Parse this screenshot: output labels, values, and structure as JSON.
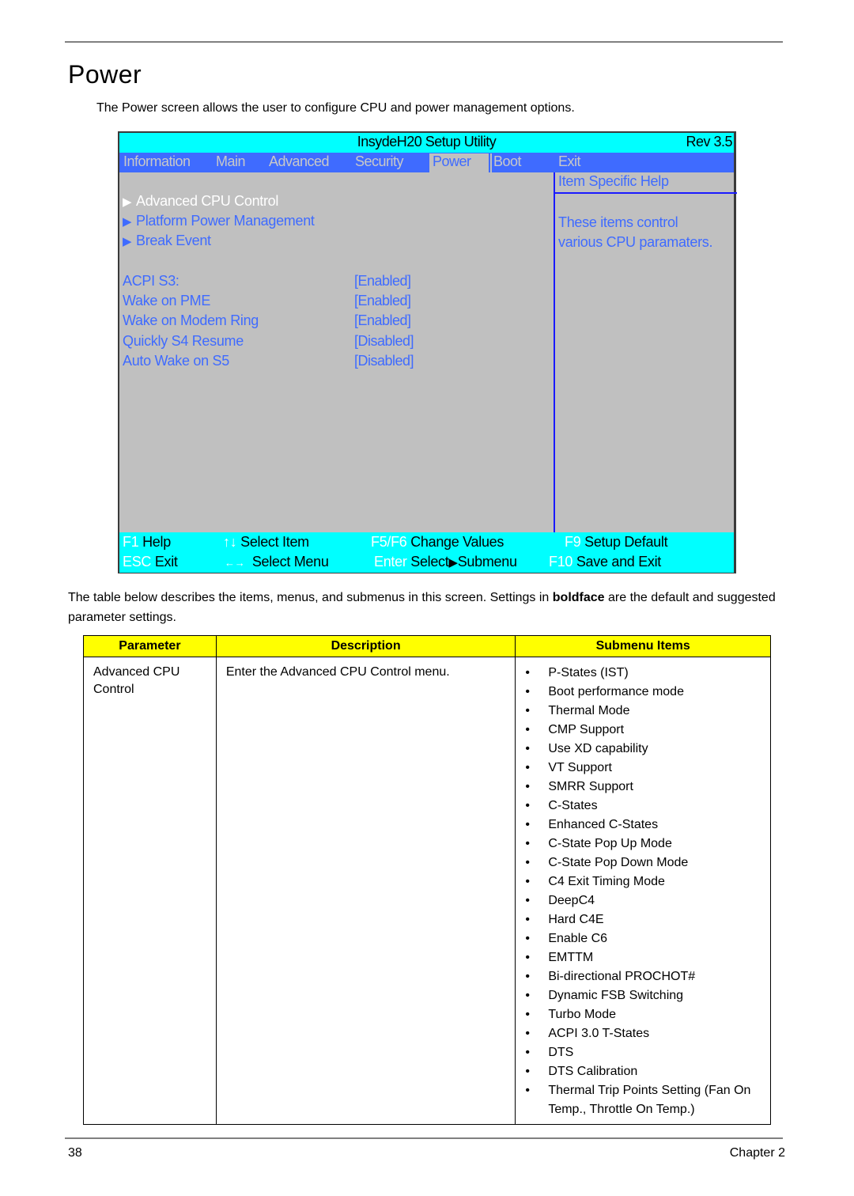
{
  "page": {
    "title": "Power",
    "intro": "The Power screen allows the user to configure CPU and power management options.",
    "description_pre": "The table below describes the items, menus, and submenus in this screen. Settings in ",
    "description_bold": "boldface",
    "description_post": " are the default and suggested parameter settings.",
    "page_number": "38",
    "chapter": "Chapter 2"
  },
  "bios": {
    "title": "InsydeH20 Setup Utility",
    "rev": "Rev 3.5",
    "tabs": [
      {
        "label": "Information",
        "active": false
      },
      {
        "label": "Main",
        "active": false
      },
      {
        "label": "Advanced",
        "active": false
      },
      {
        "label": "Security",
        "active": false
      },
      {
        "label": "Power",
        "active": true
      },
      {
        "label": "Boot",
        "active": false
      },
      {
        "label": "Exit",
        "active": false
      }
    ],
    "submenus": [
      {
        "label": "Advanced CPU Control",
        "selected": true,
        "icon": "triangle-right-icon"
      },
      {
        "label": "Platform Power Management",
        "selected": false,
        "icon": "triangle-right-icon"
      },
      {
        "label": "Break Event",
        "selected": false,
        "icon": "triangle-right-icon"
      }
    ],
    "submenu_arrow": "▶",
    "options": [
      {
        "label": "ACPI S3:",
        "value": "[Enabled]"
      },
      {
        "label": "Wake on PME",
        "value": "[Enabled]"
      },
      {
        "label": "Wake on Modem Ring",
        "value": "[Enabled]"
      },
      {
        "label": "Quickly S4 Resume",
        "value": "[Disabled]"
      },
      {
        "label": "Auto Wake on S5",
        "value": "[Disabled]"
      }
    ],
    "help": {
      "title": "Item Specific Help",
      "line1": "These items control",
      "line2": "various CPU paramaters."
    },
    "footer": [
      {
        "key": "F1",
        "desc": "Help"
      },
      {
        "key": "↑↓",
        "desc": "Select Item"
      },
      {
        "key": "F5/F6",
        "desc": "Change Values"
      },
      {
        "key": "F9",
        "desc": "Setup Default"
      },
      {
        "key": "ESC",
        "desc": "Exit"
      },
      {
        "key": "←→",
        "desc": "Select Menu"
      },
      {
        "key": "Enter",
        "desc": "Select",
        "desc2": "Submenu"
      },
      {
        "key": "F10",
        "desc": "Save and Exit"
      }
    ],
    "colors": {
      "title_bar": "#00ffff",
      "menu_bar": "#3f6bff",
      "body": "#c0c0c0",
      "item_text": "#3f6bff",
      "selected_text": "#ffffff"
    }
  },
  "table": {
    "headers": [
      "Parameter",
      "Description",
      "Submenu Items"
    ],
    "header_color": "#ffff00",
    "rows": [
      {
        "parameter": "Advanced CPU Control",
        "description": "Enter the Advanced CPU Control menu.",
        "submenu_items": [
          "P-States (IST)",
          "Boot performance mode",
          "Thermal Mode",
          "CMP Support",
          "Use XD capability",
          "VT Support",
          "SMRR Support",
          "C-States",
          "Enhanced C-States",
          "C-State Pop Up Mode",
          "C-State Pop Down Mode",
          "C4 Exit Timing Mode",
          "DeepC4",
          "Hard C4E",
          "Enable C6",
          "EMTTM",
          "Bi-directional PROCHOT#",
          "Dynamic FSB Switching",
          "Turbo Mode",
          "ACPI 3.0 T-States",
          "DTS",
          "DTS Calibration",
          "Thermal Trip Points Setting (Fan On Temp., Throttle On Temp.)"
        ]
      }
    ]
  }
}
